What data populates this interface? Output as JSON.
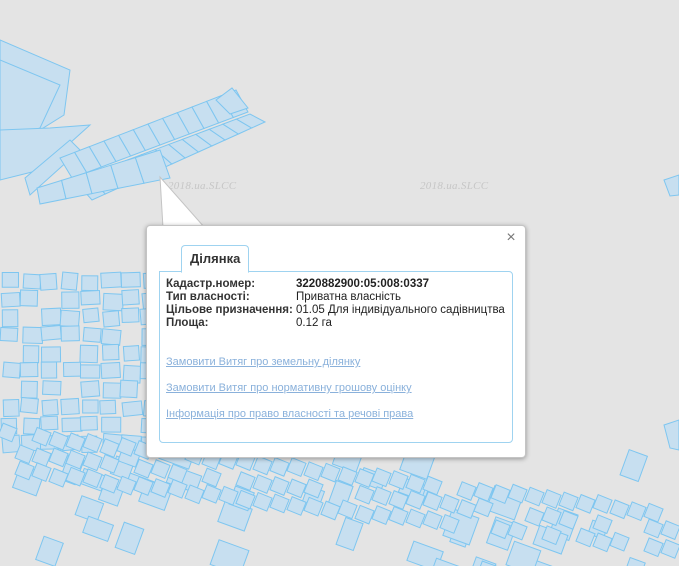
{
  "map": {
    "watermark": "2018.ua.SLCC",
    "colors": {
      "background": "#e4e4e4",
      "parcel_fill": "#c7dff0",
      "parcel_stroke": "#7ec6f0"
    }
  },
  "popup": {
    "tab_label": "Ділянка",
    "close_icon": "close-icon",
    "fields": [
      {
        "key": "Кадастр.номер:",
        "value": "3220882900:05:008:0337"
      },
      {
        "key": "Тип власності:",
        "value": "Приватна власність"
      },
      {
        "key": "Цільове призначення:",
        "value": "01.05 Для індивідуального садівництва"
      },
      {
        "key": "Площа:",
        "value": "0.12 га"
      }
    ],
    "links": [
      "Замовити Витяг про земельну ділянку",
      "Замовити Витяг про нормативну грошову оцінку",
      "Інформація про право власності та речові права"
    ]
  }
}
